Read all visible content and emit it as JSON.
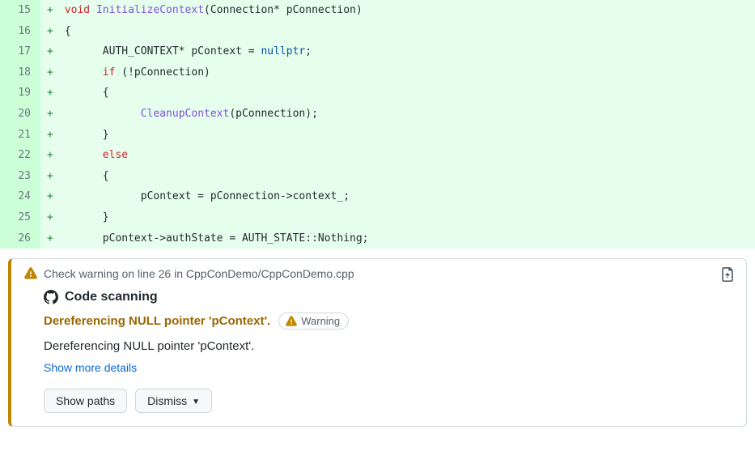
{
  "code": {
    "lines": [
      {
        "num": "15",
        "html": " <span class='kw'>void</span> <span class='fn'>InitializeContext</span>(Connection* pConnection)"
      },
      {
        "num": "16",
        "html": " {"
      },
      {
        "num": "17",
        "html": "       AUTH_CONTEXT* pContext = <span class='nl'>nullptr</span>;"
      },
      {
        "num": "18",
        "html": "       <span class='kw'>if</span> (!pConnection)"
      },
      {
        "num": "19",
        "html": "       {"
      },
      {
        "num": "20",
        "html": "             <span class='fn'>CleanupContext</span>(pConnection);"
      },
      {
        "num": "21",
        "html": "       }"
      },
      {
        "num": "22",
        "html": "       <span class='kw'>else</span>"
      },
      {
        "num": "23",
        "html": "       {"
      },
      {
        "num": "24",
        "html": "             pContext = pConnection->context_;"
      },
      {
        "num": "25",
        "html": "       }"
      },
      {
        "num": "26",
        "html": "       pContext->authState = AUTH_STATE::Nothing;"
      }
    ]
  },
  "plus": "+",
  "warning": {
    "header": "Check warning on line 26 in CppConDemo/CppConDemo.cpp",
    "scan_title": "Code scanning",
    "alert_title": "Dereferencing NULL pointer 'pContext'.",
    "severity": "Warning",
    "description": "Dereferencing NULL pointer 'pContext'.",
    "more": "Show more details",
    "btn_paths": "Show paths",
    "btn_dismiss": "Dismiss"
  }
}
